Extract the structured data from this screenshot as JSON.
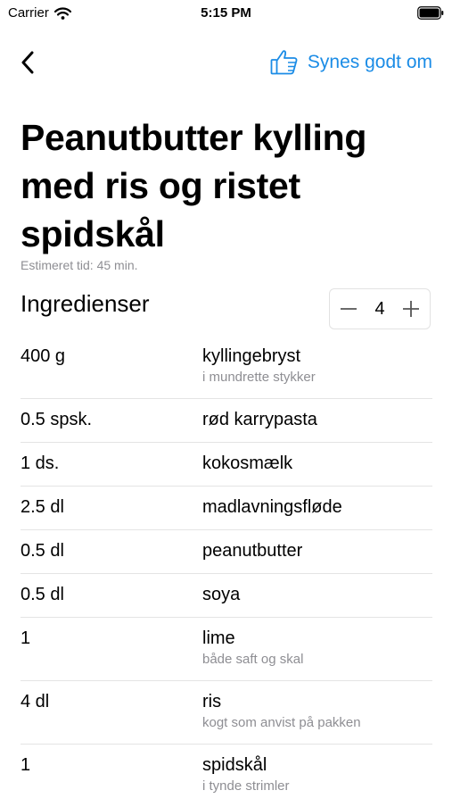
{
  "status": {
    "carrier": "Carrier",
    "time": "5:15 PM"
  },
  "nav": {
    "like_label": "Synes godt om",
    "accent": "#1b8ce6"
  },
  "recipe": {
    "title": "Peanutbutter kylling med ris og ristet spidskål",
    "estimated_time": "Estimeret tid: 45 min."
  },
  "ingredients_section": {
    "heading": "Ingredienser",
    "servings": "4"
  },
  "ingredients": [
    {
      "amount": "400 g",
      "name": "kyllingebryst",
      "note": "i mundrette stykker"
    },
    {
      "amount": "0.5 spsk.",
      "name": "rød karrypasta"
    },
    {
      "amount": "1 ds.",
      "name": "kokosmælk"
    },
    {
      "amount": "2.5 dl",
      "name": "madlavningsfløde"
    },
    {
      "amount": "0.5 dl",
      "name": "peanutbutter"
    },
    {
      "amount": "0.5 dl",
      "name": "soya"
    },
    {
      "amount": "1",
      "name": "lime",
      "note": "både saft og skal"
    },
    {
      "amount": "4 dl",
      "name": "ris",
      "note": "kogt som anvist på pakken"
    },
    {
      "amount": "1",
      "name": "spidskål",
      "note": "i tynde strimler"
    }
  ]
}
